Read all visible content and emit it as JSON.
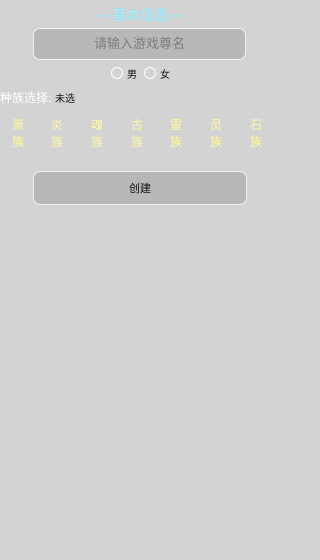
{
  "header": {
    "title": "---基本信息---"
  },
  "name_field": {
    "placeholder": "请输入游戏尊名",
    "value": ""
  },
  "gender": {
    "options": [
      {
        "label": "男",
        "selected": false
      },
      {
        "label": "女",
        "selected": false
      }
    ]
  },
  "race": {
    "label": "种族选择:",
    "selected_value": "未选",
    "options": [
      {
        "name": "萧族",
        "char1": "萧",
        "char2": "族"
      },
      {
        "name": "炎族",
        "char1": "炎",
        "char2": "族"
      },
      {
        "name": "魂族",
        "char1": "魂",
        "char2": "族"
      },
      {
        "name": "古族",
        "char1": "古",
        "char2": "族"
      },
      {
        "name": "雷族",
        "char1": "雷",
        "char2": "族"
      },
      {
        "name": "灵族",
        "char1": "灵",
        "char2": "族"
      },
      {
        "name": "石族",
        "char1": "石",
        "char2": "族"
      }
    ]
  },
  "actions": {
    "create_label": "创建"
  },
  "colors": {
    "background": "#d3d3d3",
    "title": "#a8f1ff",
    "race_text": "#fff8a0",
    "control_fill": "#b8b8b8"
  }
}
